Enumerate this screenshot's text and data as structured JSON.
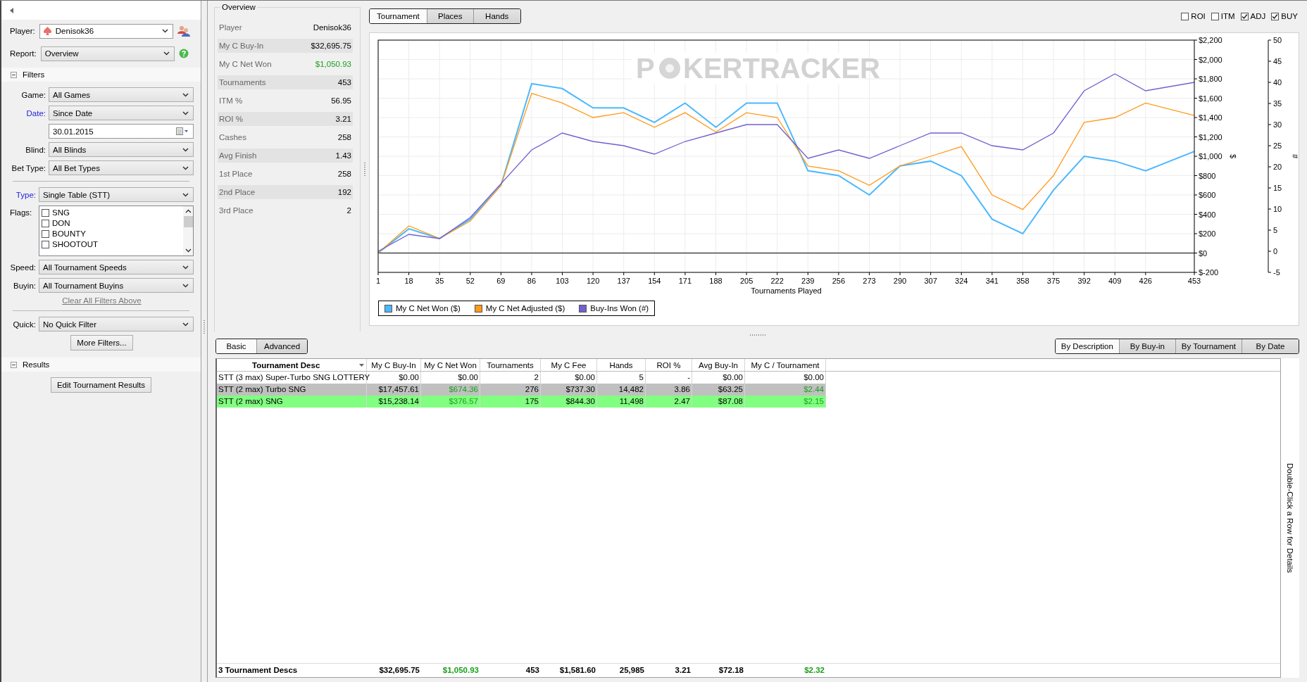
{
  "sidebar": {
    "player": {
      "label": "Player:",
      "value": "Denisok36"
    },
    "report": {
      "label": "Report:",
      "value": "Overview"
    },
    "filters_section": {
      "title": "Filters",
      "expanded": true
    },
    "filter_groups": [
      [
        {
          "kind": "select",
          "label": "Game:",
          "value": "All Games",
          "link": false
        },
        {
          "kind": "select",
          "label": "Date:",
          "value": "Since Date",
          "link": true
        },
        {
          "kind": "date",
          "value": "30.01.2015"
        },
        {
          "kind": "select",
          "label": "Blind:",
          "value": "All Blinds",
          "link": false
        },
        {
          "kind": "select",
          "label": "Bet Type:",
          "value": "All Bet Types",
          "link": false
        }
      ],
      [
        {
          "kind": "select",
          "label": "Type:",
          "value": "Single Table (STT)",
          "link": true
        },
        {
          "kind": "list",
          "label": "Flags:",
          "link": false,
          "items": [
            {
              "label": "SNG",
              "checked": false
            },
            {
              "label": "DON",
              "checked": false
            },
            {
              "label": "BOUNTY",
              "checked": false
            },
            {
              "label": "SHOOTOUT",
              "checked": false
            }
          ]
        },
        {
          "kind": "select",
          "label": "Speed:",
          "value": "All Tournament Speeds",
          "link": false
        },
        {
          "kind": "select",
          "label": "Buyin:",
          "value": "All Tournament Buyins",
          "link": false
        },
        {
          "kind": "link",
          "value": "Clear All Filters Above"
        }
      ],
      [
        {
          "kind": "select",
          "label": "Quick:",
          "value": "No Quick Filter",
          "link": false
        },
        {
          "kind": "button",
          "value": "More Filters..."
        }
      ]
    ],
    "results_section": {
      "title": "Results",
      "expanded": true
    },
    "results_button": "Edit Tournament Results"
  },
  "overview": {
    "title": "Overview",
    "rows": [
      {
        "label": "Player",
        "value": "Denisok36",
        "profit": false
      },
      {
        "label": "My C Buy-In",
        "value": "$32,695.75",
        "profit": false
      },
      {
        "label": "My C Net Won",
        "value": "$1,050.93",
        "profit": true
      },
      {
        "label": "Tournaments",
        "value": "453",
        "profit": false
      },
      {
        "label": "ITM %",
        "value": "56.95",
        "profit": false
      },
      {
        "label": "ROI %",
        "value": "3.21",
        "profit": false
      },
      {
        "label": "Cashes",
        "value": "258",
        "profit": false
      },
      {
        "label": "Avg Finish",
        "value": "1.43",
        "profit": false
      },
      {
        "label": "1st Place",
        "value": "258",
        "profit": false
      },
      {
        "label": "2nd Place",
        "value": "192",
        "profit": false
      },
      {
        "label": "3rd Place",
        "value": "2",
        "profit": false
      }
    ]
  },
  "graph": {
    "tabs": [
      {
        "label": "Tournament",
        "selected": true
      },
      {
        "label": "Places",
        "selected": false
      },
      {
        "label": "Hands",
        "selected": false
      }
    ],
    "toggles": [
      {
        "label": "ROI",
        "checked": false
      },
      {
        "label": "ITM",
        "checked": false
      },
      {
        "label": "ADJ",
        "checked": true
      },
      {
        "label": "BUY",
        "checked": true
      }
    ],
    "watermark": [
      "P",
      "KERTRACKER"
    ],
    "chart_data": {
      "type": "line",
      "grid": true,
      "xlabel": "Tournaments Played",
      "ylabel": "$",
      "y2label": "#",
      "xlim": [
        1,
        453
      ],
      "x": [
        1,
        18,
        35,
        52,
        69,
        86,
        103,
        120,
        137,
        154,
        171,
        188,
        205,
        222,
        239,
        256,
        273,
        290,
        307,
        324,
        341,
        358,
        375,
        392,
        409,
        426,
        453
      ],
      "series": [
        {
          "name": "My C Net Won ($)",
          "color": "#4cb8ff",
          "values": [
            0,
            250,
            150,
            350,
            700,
            1750,
            1700,
            1500,
            1500,
            1350,
            1550,
            1300,
            1550,
            1550,
            850,
            800,
            600,
            900,
            950,
            800,
            350,
            200,
            650,
            1000,
            950,
            850,
            1050
          ]
        },
        {
          "name": "My C Net Adjusted ($)",
          "color": "#ff9a1a",
          "values": [
            0,
            280,
            150,
            330,
            700,
            1650,
            1550,
            1400,
            1450,
            1300,
            1450,
            1250,
            1450,
            1400,
            900,
            850,
            700,
            900,
            1000,
            1100,
            600,
            450,
            800,
            1350,
            1400,
            1550,
            1420
          ]
        },
        {
          "name": "Buy-Ins Won (#)",
          "color": "#7060d0",
          "axis": "y2",
          "values": [
            0,
            4,
            3,
            8,
            16,
            24,
            28,
            26,
            25,
            23,
            26,
            28,
            30,
            30,
            22,
            24,
            22,
            25,
            28,
            28,
            25,
            24,
            28,
            38,
            42,
            38,
            40
          ]
        }
      ],
      "xticks": [
        1,
        18,
        35,
        52,
        69,
        86,
        103,
        120,
        137,
        154,
        171,
        188,
        205,
        222,
        239,
        256,
        273,
        290,
        307,
        324,
        341,
        358,
        375,
        392,
        409,
        426,
        453
      ],
      "ylim": [
        -200,
        2200
      ],
      "yticks": [
        {
          "value": -200,
          "label": "$-200"
        },
        {
          "value": 0,
          "label": "$0"
        },
        {
          "value": 200,
          "label": "$200"
        },
        {
          "value": 400,
          "label": "$400"
        },
        {
          "value": 600,
          "label": "$600"
        },
        {
          "value": 800,
          "label": "$800"
        },
        {
          "value": 1000,
          "label": "$1,000"
        },
        {
          "value": 1200,
          "label": "$1,200"
        },
        {
          "value": 1400,
          "label": "$1,400"
        },
        {
          "value": 1600,
          "label": "$1,600"
        },
        {
          "value": 1800,
          "label": "$1,800"
        },
        {
          "value": 2000,
          "label": "$2,000"
        },
        {
          "value": 2200,
          "label": "$2,200"
        }
      ],
      "y2lim": [
        -5,
        50
      ],
      "y2ticks": [
        -5,
        0,
        5,
        10,
        15,
        20,
        25,
        30,
        35,
        40,
        45,
        50
      ]
    }
  },
  "results": {
    "view_tabs": [
      {
        "label": "Basic",
        "selected": true
      },
      {
        "label": "Advanced",
        "selected": false
      }
    ],
    "group_tabs": [
      {
        "label": "By Description",
        "selected": true
      },
      {
        "label": "By Buy-in",
        "selected": false
      },
      {
        "label": "By Tournament",
        "selected": false
      },
      {
        "label": "By Date",
        "selected": false
      }
    ],
    "columns": [
      {
        "label": "Tournament Desc",
        "kind": "text",
        "sorted": true
      },
      {
        "label": "My C Buy-In",
        "kind": "num",
        "sorted": false
      },
      {
        "label": "My C Net Won",
        "kind": "profit",
        "sorted": false
      },
      {
        "label": "Tournaments",
        "kind": "num",
        "sorted": false
      },
      {
        "label": "My C Fee",
        "kind": "num",
        "sorted": false
      },
      {
        "label": "Hands",
        "kind": "num",
        "sorted": false
      },
      {
        "label": "ROI %",
        "kind": "num",
        "sorted": false
      },
      {
        "label": "Avg Buy-In",
        "kind": "num",
        "sorted": false
      },
      {
        "label": "My C / Tournament",
        "kind": "profit",
        "sorted": false
      }
    ],
    "rows": [
      {
        "color": "#ffffff",
        "profit": false,
        "cells": [
          "STT (3 max) Super-Turbo SNG LOTTERY",
          "$0.00",
          "$0.00",
          "2",
          "$0.00",
          "5",
          "-",
          "$0.00",
          "$0.00"
        ]
      },
      {
        "color": "#c0c0c0",
        "profit": true,
        "cells": [
          "STT (2 max) Turbo SNG",
          "$17,457.61",
          "$674.36",
          "276",
          "$737.30",
          "14,482",
          "3.86",
          "$63.25",
          "$2.44"
        ]
      },
      {
        "color": "#80ff80",
        "profit": true,
        "cells": [
          "STT (2 max) SNG",
          "$15,238.14",
          "$376.57",
          "175",
          "$844.30",
          "11,498",
          "2.47",
          "$87.08",
          "$2.15"
        ]
      }
    ],
    "totals": {
      "profit": true,
      "cells": [
        "3 Tournament Descs",
        "$32,695.75",
        "$1,050.93",
        "453",
        "$1,581.60",
        "25,985",
        "3.21",
        "$72.18",
        "$2.32"
      ]
    },
    "hint": "Double-Click a Row for Details"
  }
}
